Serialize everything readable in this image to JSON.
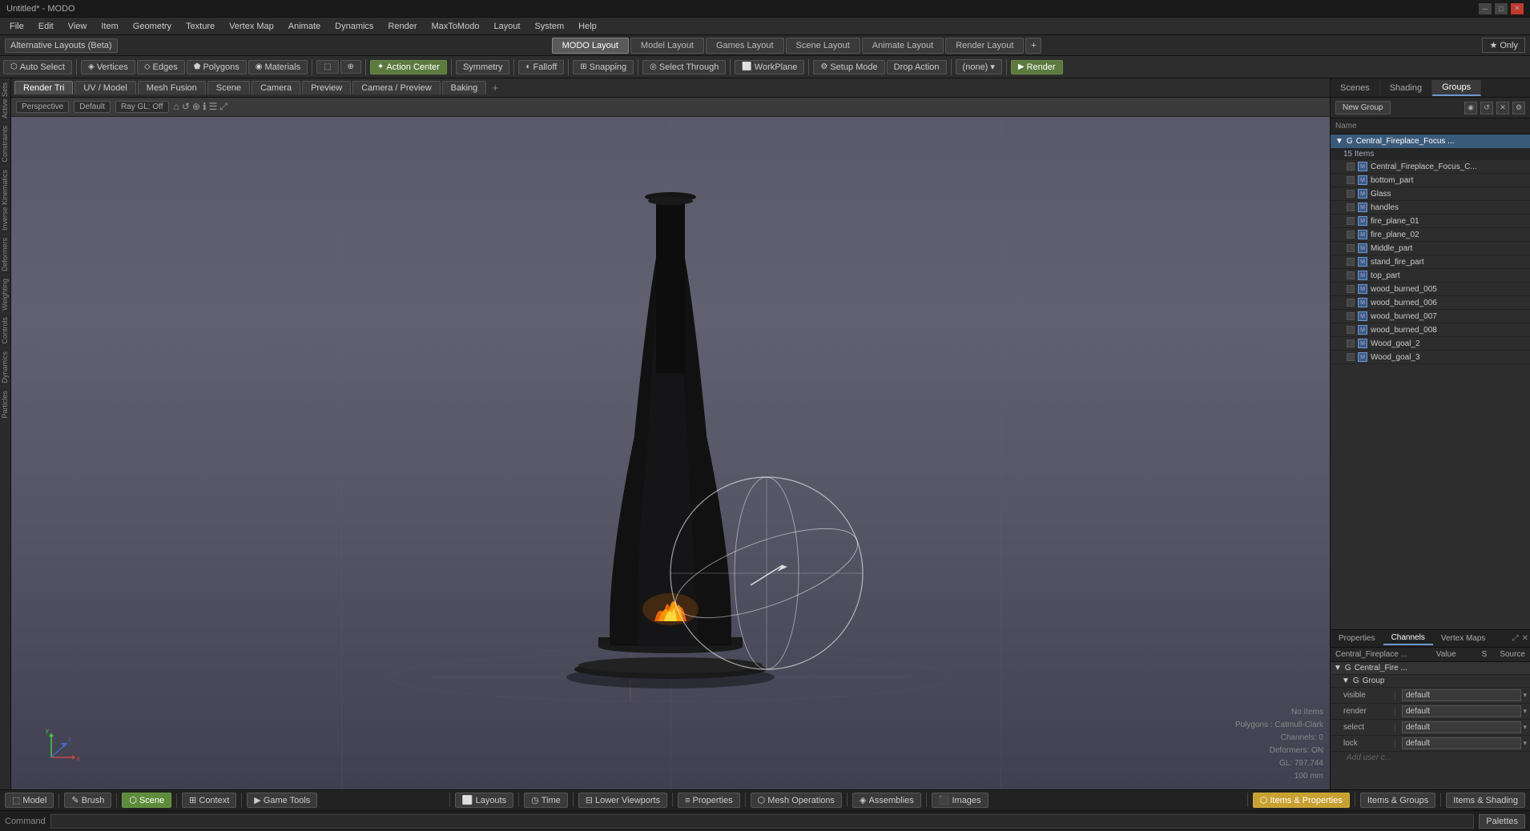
{
  "app": {
    "title": "Untitled* - MODO",
    "window_controls": [
      "minimize",
      "maximize",
      "close"
    ]
  },
  "menu": {
    "items": [
      "File",
      "Edit",
      "View",
      "Item",
      "Geometry",
      "Texture",
      "Vertex Map",
      "Animate",
      "Dynamics",
      "Render",
      "MaxToModo",
      "Layout",
      "System",
      "Help"
    ]
  },
  "layout_selector": {
    "dropdown_label": "Alternative Layouts (Beta)",
    "tabs": [
      "MODO Layout",
      "Model Layout",
      "Games Layout",
      "Scene Layout",
      "Animate Layout",
      "Render Layout"
    ],
    "active_tab": "MODO Layout",
    "add_btn": "+",
    "only_btn": "★  Only"
  },
  "toolbar": {
    "auto_select": "Auto Select",
    "vertices": "Vertices",
    "edges": "Edges",
    "polygons": "Polygons",
    "materials": "Materials",
    "action_center": "Action Center",
    "symmetry": "Symmetry",
    "falloff": "Falloff",
    "snapping": "Snapping",
    "select_through": "Select Through",
    "workplane": "WorkPlane",
    "setup_mode": "Setup Mode",
    "drop_action": "Drop Action",
    "none_label": "(none)",
    "render_btn": "Render"
  },
  "viewport": {
    "tabs": [
      "Render Tri",
      "UV / Model",
      "Mesh Fusion",
      "Scene",
      "Camera",
      "Preview",
      "Camera / Preview",
      "Baking"
    ],
    "active_tab": "Render Tri",
    "perspective": "Perspective",
    "shading": "Default",
    "ray_gl": "Ray GL: Off"
  },
  "scene": {
    "tabs": [
      "Scenes",
      "Shading",
      "Groups"
    ],
    "active_tab": "Groups",
    "new_group_btn": "New Group",
    "name_col": "Name",
    "group_name": "Central_Fireplace_Focus ...",
    "items_count": "15 Items",
    "items": [
      "Central_Fireplace_Focus_C...",
      "bottom_part",
      "Glass",
      "handles",
      "fire_plane_01",
      "fire_plane_02",
      "Middle_part",
      "stand_fire_part",
      "top_part",
      "wood_burned_005",
      "wood_burned_006",
      "wood_burned_007",
      "wood_burned_008",
      "Wood_goal_2",
      "Wood_goal_3"
    ]
  },
  "properties": {
    "tabs": [
      "Properties",
      "Channels",
      "Vertex Maps"
    ],
    "active_tab": "Channels",
    "cols": [
      "Central_Fireplace ...",
      "Value",
      "S",
      "Source"
    ],
    "group_label": "Central_Fire ...",
    "sub_group": "Group",
    "rows": [
      {
        "name": "visible",
        "value": "default",
        "source": ""
      },
      {
        "name": "render",
        "value": "default",
        "source": ""
      },
      {
        "name": "select",
        "value": "default",
        "source": ""
      },
      {
        "name": "lock",
        "value": "default",
        "source": ""
      }
    ],
    "add_user": "Add user c..."
  },
  "info_overlay": {
    "no_items": "No Items",
    "polygons": "Polygons : Catmull-Clark",
    "channels": "Channels: 0",
    "deformers": "Deformers: ON",
    "gl_coords": "GL: 797,744",
    "unit": "100 mm"
  },
  "bottom_bar": {
    "tools": [
      "Model",
      "Brush",
      "Scene",
      "Context",
      "Game Tools"
    ],
    "active": "Scene",
    "center_tools": [
      "Layouts",
      "Time",
      "Lower Viewports",
      "Properties",
      "Mesh Operations",
      "Assemblies",
      "Images"
    ]
  },
  "command_bar": {
    "label": "Command",
    "placeholder": "",
    "palettes_btn": "Palettes",
    "items_props": "Items & Properties",
    "items_groups": "Items & Groups",
    "items_shading": "Items & Shading"
  },
  "left_strips": [
    "Active Sets",
    "Constraints",
    "Inverse Kinematics",
    "Deformers",
    "Weighting",
    "Controls",
    "Dynamics",
    "Particles"
  ]
}
